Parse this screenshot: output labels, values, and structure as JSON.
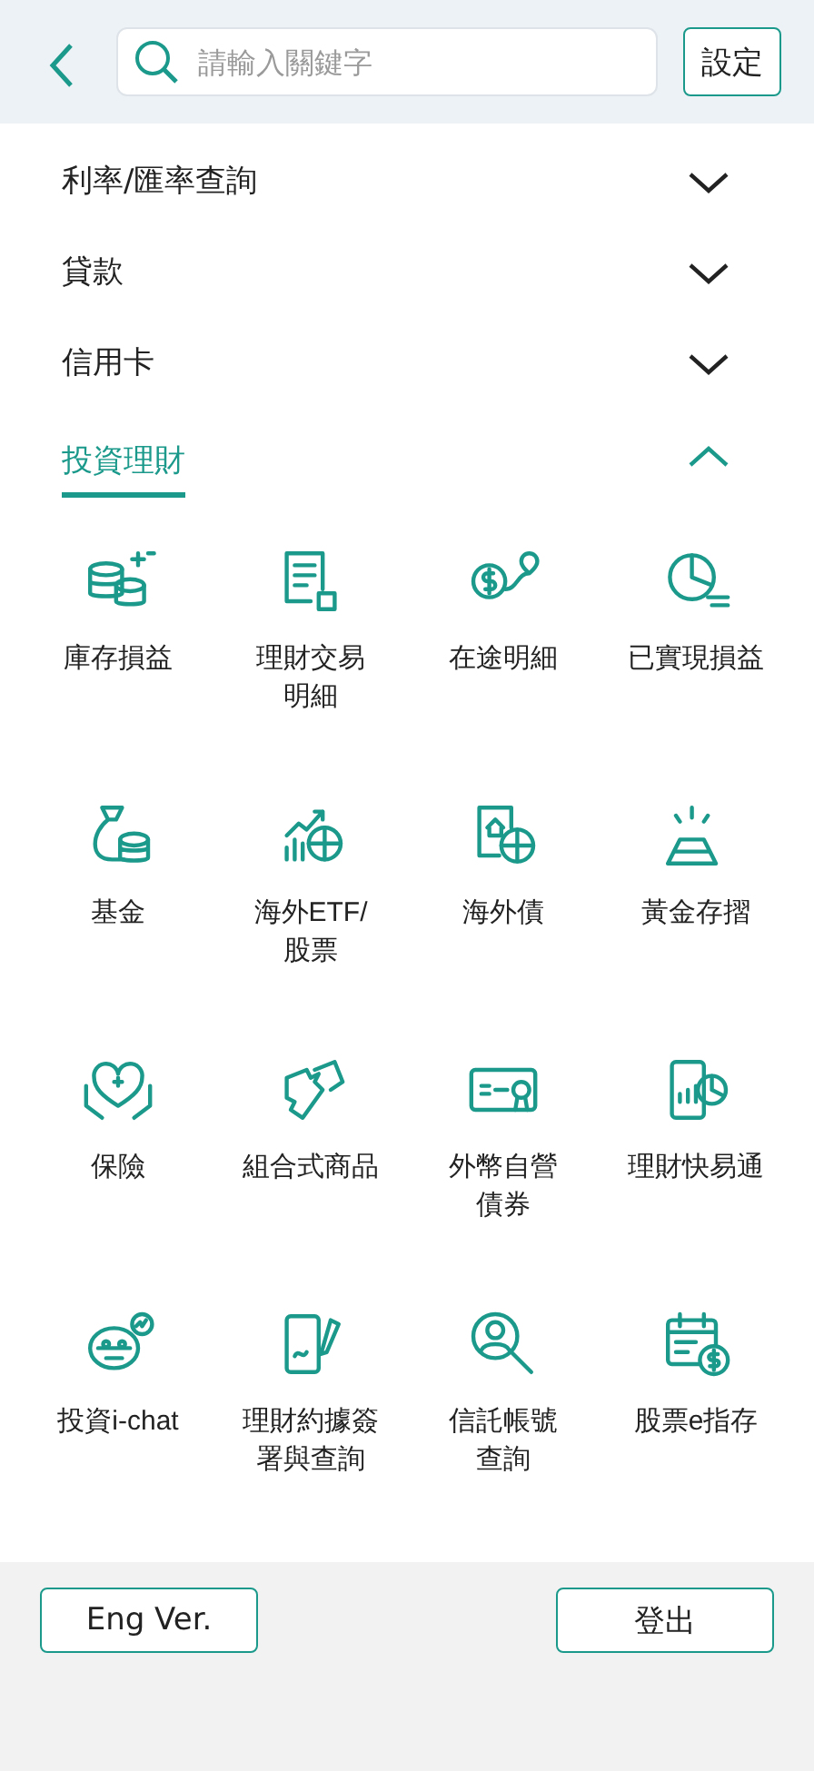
{
  "header": {
    "search": {
      "placeholder": "請輸入關鍵字"
    },
    "settings_button": "設定"
  },
  "sections": [
    {
      "label": "利率/匯率查詢",
      "expanded": false
    },
    {
      "label": "貸款",
      "expanded": false
    },
    {
      "label": "信用卡",
      "expanded": false
    },
    {
      "label": "投資理財",
      "expanded": true,
      "items": [
        {
          "label": "庫存損益"
        },
        {
          "label": [
            "理財交易",
            "明細"
          ]
        },
        {
          "label": "在途明細"
        },
        {
          "label": "已實現損益"
        },
        {
          "label": "基金"
        },
        {
          "label": [
            "海外ETF/",
            "股票"
          ]
        },
        {
          "label": "海外債"
        },
        {
          "label": "黃金存摺"
        },
        {
          "label": "保險"
        },
        {
          "label": "組合式商品"
        },
        {
          "label": [
            "外幣自營",
            "債券"
          ]
        },
        {
          "label": "理財快易通"
        },
        {
          "label": "投資i-chat"
        },
        {
          "label": [
            "理財約據簽",
            "署與查詢"
          ]
        },
        {
          "label": [
            "信託帳號",
            "查詢"
          ]
        },
        {
          "label": "股票e指存"
        }
      ]
    }
  ],
  "footer": {
    "buttons": [
      "Eng Ver.",
      "登出"
    ]
  }
}
